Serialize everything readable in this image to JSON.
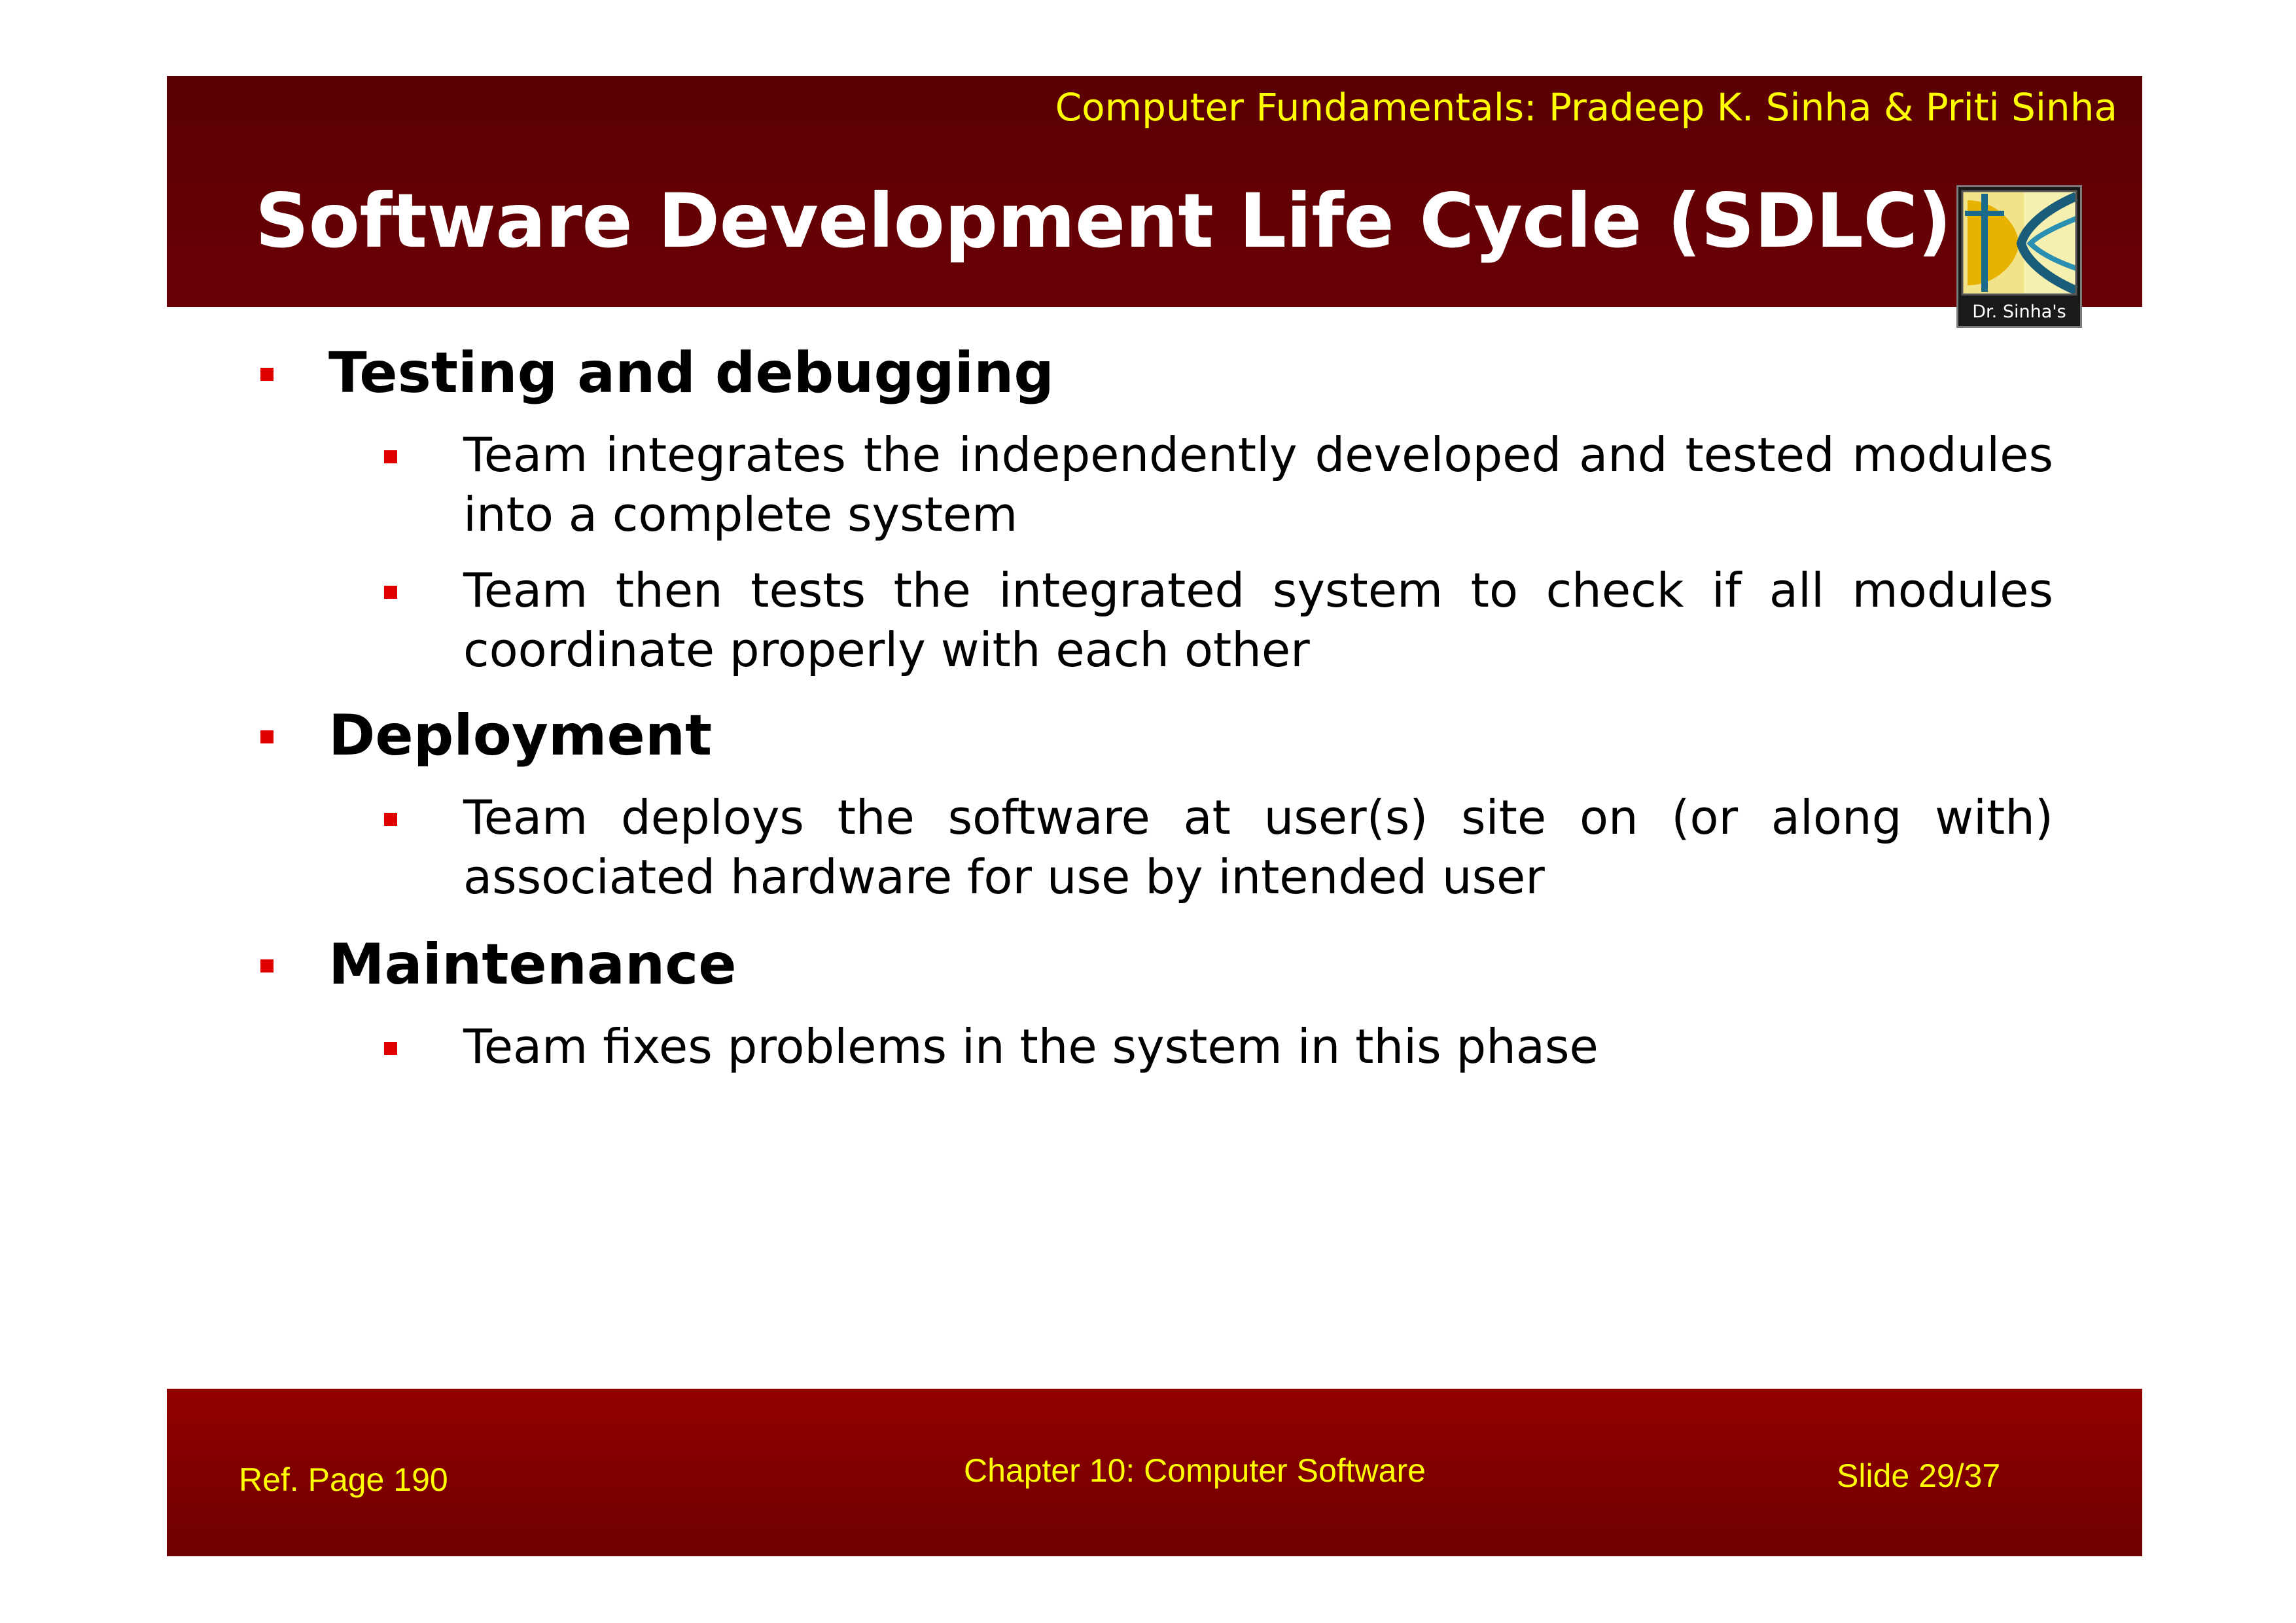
{
  "header": {
    "book_credit": "Computer Fundamentals: Pradeep K. Sinha & Priti Sinha",
    "title": "Software Development Life Cycle (SDLC)",
    "logo_text": "Dr. Sinha's",
    "logo_icon": "dr-sinhas-logo-icon"
  },
  "colors": {
    "header_bg": "#5c0003",
    "footer_bg": "#8b0000",
    "accent_text": "#ffff00",
    "bullet": "#e00000"
  },
  "sections": [
    {
      "heading": "Testing and debugging",
      "points": [
        "Team integrates the independently developed and tested modules into a complete system",
        "Team then tests the integrated system to check if all modules coordinate properly with each other"
      ]
    },
    {
      "heading": "Deployment",
      "points": [
        "Team deploys the software at user(s) site on (or along with) associated hardware for use by intended user"
      ]
    },
    {
      "heading": "Maintenance",
      "points": [
        "Team fixes problems in the system in this phase"
      ]
    }
  ],
  "footer": {
    "ref_page": "Ref. Page 190",
    "chapter": "Chapter 10: Computer Software",
    "slide": "Slide 29/37"
  }
}
